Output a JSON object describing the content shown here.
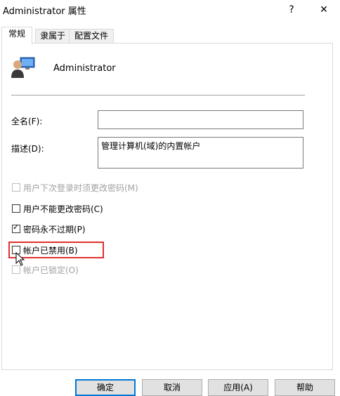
{
  "window": {
    "title": "Administrator 属性",
    "help_glyph": "?",
    "close_glyph": "✕"
  },
  "tabs": [
    {
      "label": "常规",
      "active": true
    },
    {
      "label": "隶属于",
      "active": false
    },
    {
      "label": "配置文件",
      "active": false
    }
  ],
  "general": {
    "user_name": "Administrator",
    "fullname_label": "全名(F):",
    "fullname_value": "",
    "description_label": "描述(D):",
    "description_value": "管理计算机(域)的内置帐户",
    "checkboxes": [
      {
        "label": "用户下次登录时须更改密码(M)",
        "checked": false,
        "enabled": false
      },
      {
        "label": "用户不能更改密码(C)",
        "checked": false,
        "enabled": true
      },
      {
        "label": "密码永不过期(P)",
        "checked": true,
        "enabled": true
      },
      {
        "label": "帐户已禁用(B)",
        "checked": false,
        "enabled": true,
        "highlighted": true
      },
      {
        "label": "帐户已锁定(O)",
        "checked": false,
        "enabled": false
      }
    ]
  },
  "buttons": {
    "ok": "确定",
    "cancel": "取消",
    "apply": "应用(A)",
    "help": "帮助"
  },
  "colors": {
    "highlight_box": "#e0302e",
    "default_button_border": "#0078d7"
  },
  "icons": [
    "user-account-icon",
    "help-icon",
    "close-icon",
    "checkmark-icon",
    "mouse-cursor-icon"
  ]
}
